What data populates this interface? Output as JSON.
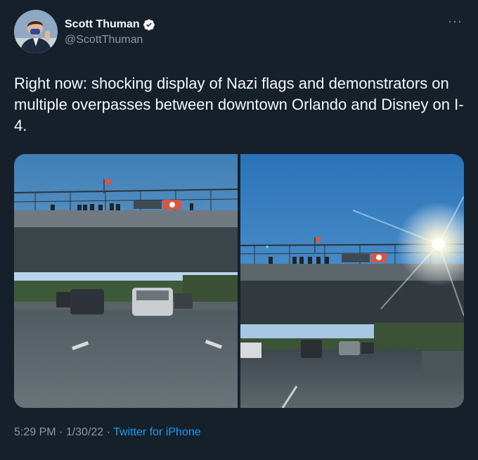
{
  "author": {
    "display_name": "Scott Thuman",
    "handle": "@ScottThuman",
    "verified_icon": "verified-badge-icon",
    "avatar_icon": "profile-photo"
  },
  "menu": {
    "more_label": "···"
  },
  "tweet": {
    "text": "Right now: shocking display of Nazi flags and demonstrators on multiple overpasses between downtown Orlando and Disney on I-4."
  },
  "media": {
    "photos": [
      {
        "description_icon": "overpass-photo-1"
      },
      {
        "description_icon": "overpass-photo-2"
      }
    ]
  },
  "meta": {
    "time": "5:29 PM",
    "sep1": " · ",
    "date": "1/30/22",
    "sep2": " · ",
    "source": "Twitter for iPhone"
  },
  "colors": {
    "background": "#15202b",
    "text": "#f7f9f9",
    "secondary": "#8b98a5",
    "link": "#1d9bf0"
  }
}
